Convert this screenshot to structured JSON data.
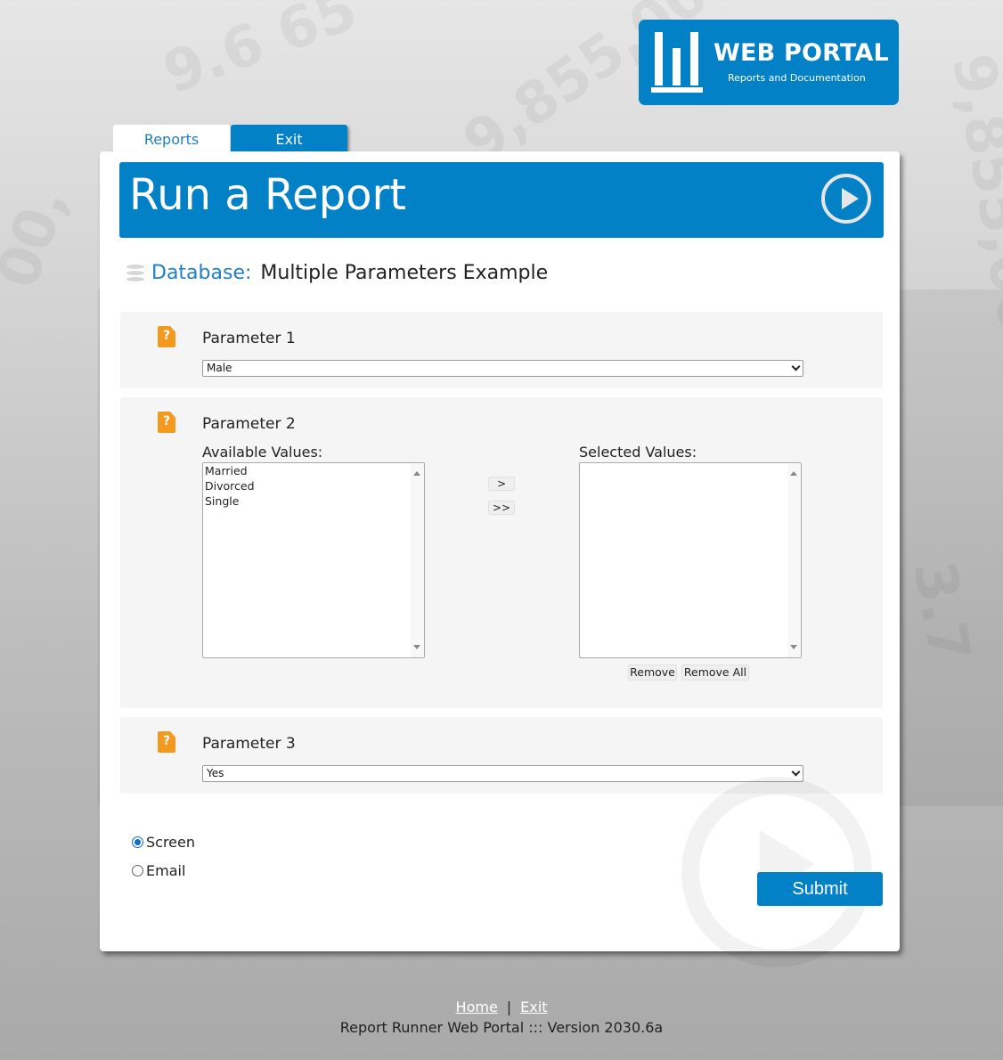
{
  "logo": {
    "title": "WEB PORTAL",
    "subtitle": "Reports and Documentation",
    "color": "#0381c7"
  },
  "tabs": [
    {
      "label": "Reports",
      "active": true
    },
    {
      "label": "Exit",
      "active": false
    }
  ],
  "header": {
    "title": "Run a Report",
    "run_icon": "play-circle-icon"
  },
  "database": {
    "label": "Database:",
    "name": "Multiple Parameters Example",
    "icon": "database-icon"
  },
  "parameters": [
    {
      "title": "Parameter 1",
      "type": "select",
      "value": "Male",
      "icon": "help-document-icon"
    },
    {
      "title": "Parameter 2",
      "type": "multi-select",
      "available_label": "Available Values:",
      "available_values": [
        "Married",
        "Divorced",
        "Single"
      ],
      "selected_label": "Selected Values:",
      "selected_values": [],
      "add_label": ">",
      "add_all_label": ">>",
      "remove_label": "Remove",
      "remove_all_label": "Remove All",
      "icon": "help-document-icon"
    },
    {
      "title": "Parameter 3",
      "type": "select",
      "value": "Yes",
      "icon": "help-document-icon"
    }
  ],
  "output": {
    "options": [
      {
        "label": "Screen",
        "checked": true
      },
      {
        "label": "Email",
        "checked": false
      }
    ]
  },
  "submit_label": "Submit",
  "footer": {
    "home_label": "Home",
    "separator": "|",
    "exit_label": "Exit",
    "version": "Report Runner Web Portal ::: Version 2030.6a"
  },
  "colors": {
    "accent": "#0381c7",
    "param_icon": "#f39a1e",
    "panel_bg": "#f5f5f5"
  }
}
